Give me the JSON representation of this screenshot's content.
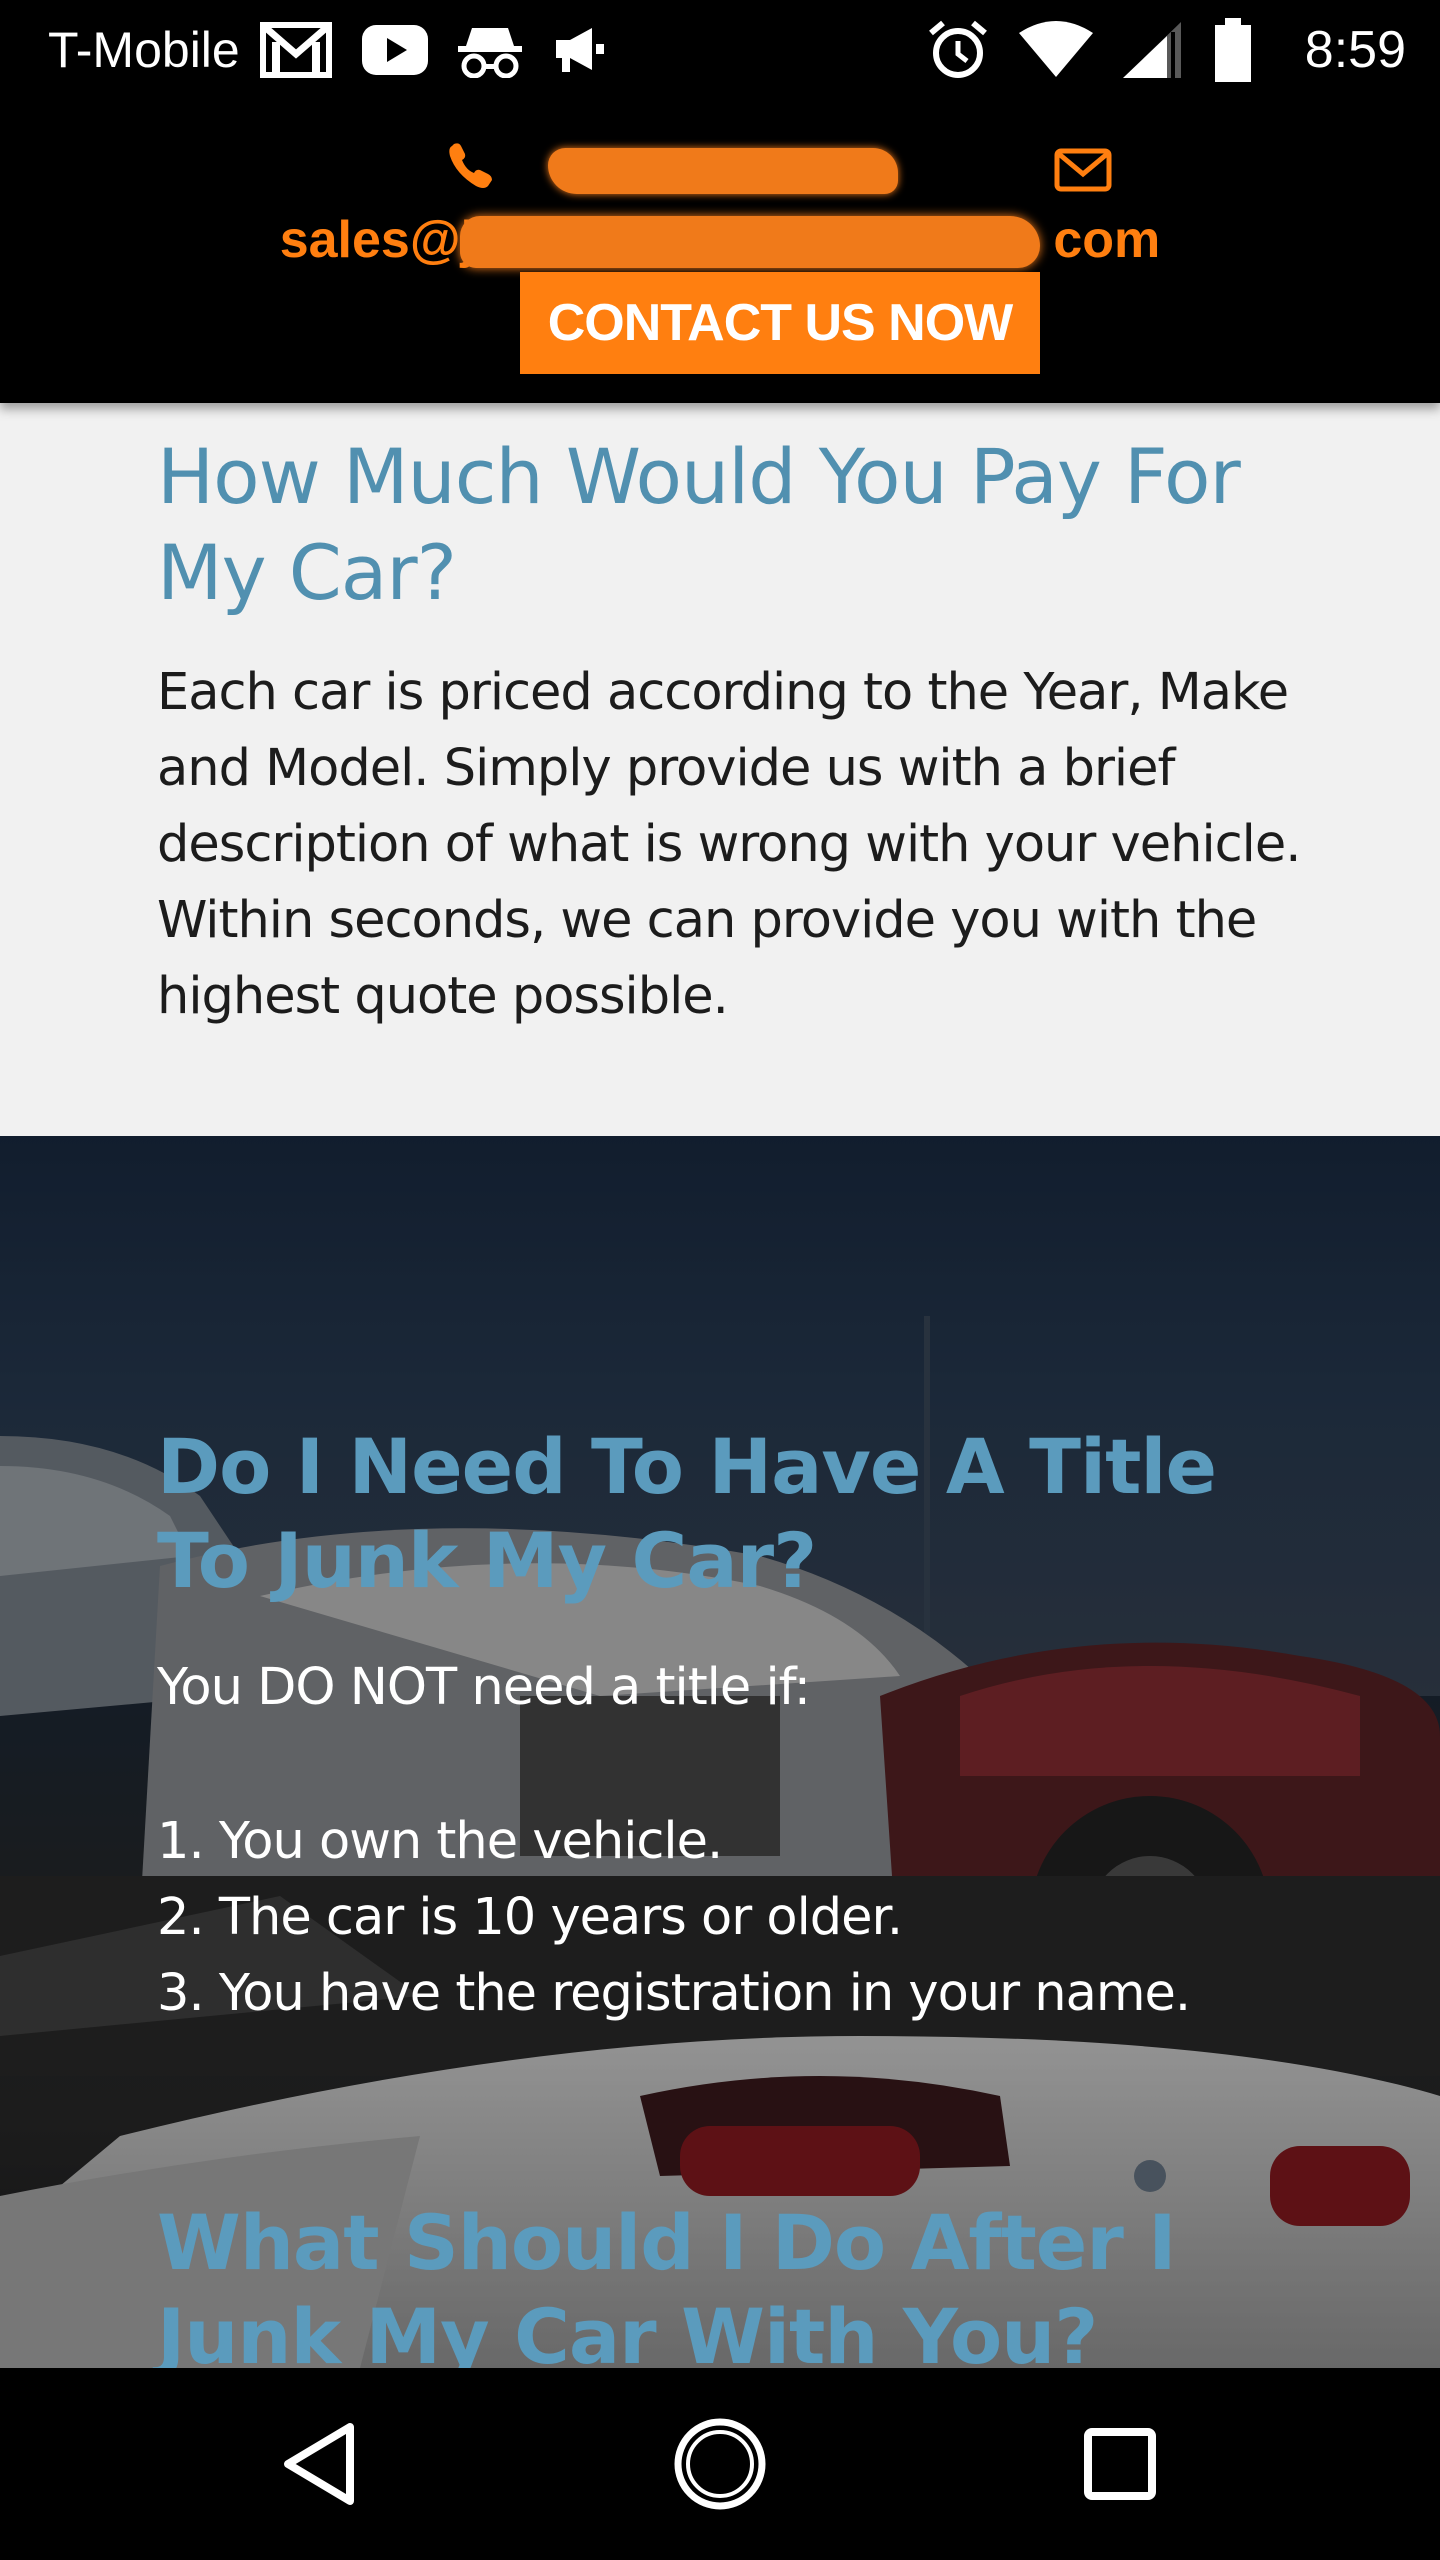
{
  "status_bar": {
    "carrier": "T-Mobile",
    "time": "8:59",
    "icons": [
      "gmail-icon",
      "youtube-icon",
      "incognito-icon",
      "megaphone-icon",
      "alarm-icon",
      "wifi-icon",
      "cell-signal-icon",
      "battery-icon"
    ]
  },
  "header": {
    "phone_icon": "phone-icon",
    "mail_icon": "mail-icon",
    "email_prefix": "sales@j",
    "email_suffix": "com",
    "contact_button": "CONTACT US NOW",
    "accent_color": "#ff7f10"
  },
  "section_price": {
    "heading": "How Much Would You Pay For My Car?",
    "body": "Each car is priced according to the Year, Make and Model. Simply provide us with a brief description of what is wrong with your vehicle. Within seconds, we can provide you with the highest quote possible."
  },
  "section_title": {
    "heading": "Do I Need To Have A Title To Junk My Car?",
    "intro": "You DO NOT need a title if:",
    "items": [
      "1. You own the vehicle.",
      "2. The car is 10 years or older.",
      "3. You have the registration in your name."
    ]
  },
  "section_after": {
    "heading": "What Should I Do After I Junk My Car With You?"
  },
  "nav_bar": {
    "buttons": [
      "back-icon",
      "home-icon",
      "recents-icon"
    ]
  },
  "colors": {
    "heading_blue": "#5190b0",
    "light_bg": "#f1f1f1",
    "orange": "#ff7f10"
  }
}
